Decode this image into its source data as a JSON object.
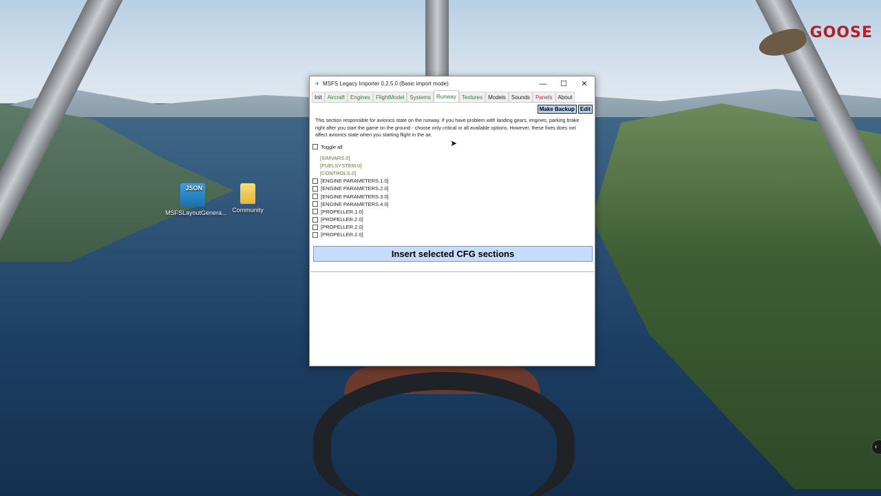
{
  "desktop": {
    "icons": [
      {
        "label": "MSFSLayoutGenera...",
        "badge": "JSON"
      },
      {
        "label": "Community"
      }
    ],
    "logo_text": "GOOSE"
  },
  "window": {
    "title": "MSFS Legacy Importer 0.2.5.0 (Basic import mode)",
    "controls": {
      "minimize": "—",
      "maximize": "☐",
      "close": "✕"
    },
    "tabs": [
      {
        "label": "Init",
        "state": "neutral"
      },
      {
        "label": "Aircraft",
        "state": "green"
      },
      {
        "label": "Engines",
        "state": "green"
      },
      {
        "label": "FlightModel",
        "state": "green"
      },
      {
        "label": "Systems",
        "state": "green"
      },
      {
        "label": "Runway",
        "state": "active"
      },
      {
        "label": "Textures",
        "state": "green"
      },
      {
        "label": "Models",
        "state": "neutral"
      },
      {
        "label": "Sounds",
        "state": "neutral"
      },
      {
        "label": "Panels",
        "state": "red"
      },
      {
        "label": "About",
        "state": "neutral"
      }
    ],
    "actions": {
      "make_backup": "Make Backup",
      "edit": "Edit"
    },
    "description": "This section responsible for avionics state on the runway. If you have problem with landing gears, engines, parking brake right after you start the game on the ground - choose only critical or all available options. However, these fixes does not affect avionics state when you starting flight in the air.",
    "toggle_all": "Toggle all",
    "sections": [
      {
        "label": "[SIMVARS.0]",
        "locked": true
      },
      {
        "label": "[FUELSYSTEM.0]",
        "locked": true
      },
      {
        "label": "[CONTROLS.0]",
        "locked": true
      },
      {
        "label": "[ENGINE PARAMETERS.1.0]",
        "locked": false
      },
      {
        "label": "[ENGINE PARAMETERS.2.0]",
        "locked": false
      },
      {
        "label": "[ENGINE PARAMETERS.3.0]",
        "locked": false
      },
      {
        "label": "[ENGINE PARAMETERS.4.0]",
        "locked": false
      },
      {
        "label": "[PROPELLER.1.0]",
        "locked": false
      },
      {
        "label": "[PROPELLER.2.0]",
        "locked": false
      },
      {
        "label": "[PROPELLER.2.0]",
        "locked": false
      },
      {
        "label": "[PROPELLER.2.0]",
        "locked": false
      }
    ],
    "insert_button": "Insert selected CFG sections"
  }
}
